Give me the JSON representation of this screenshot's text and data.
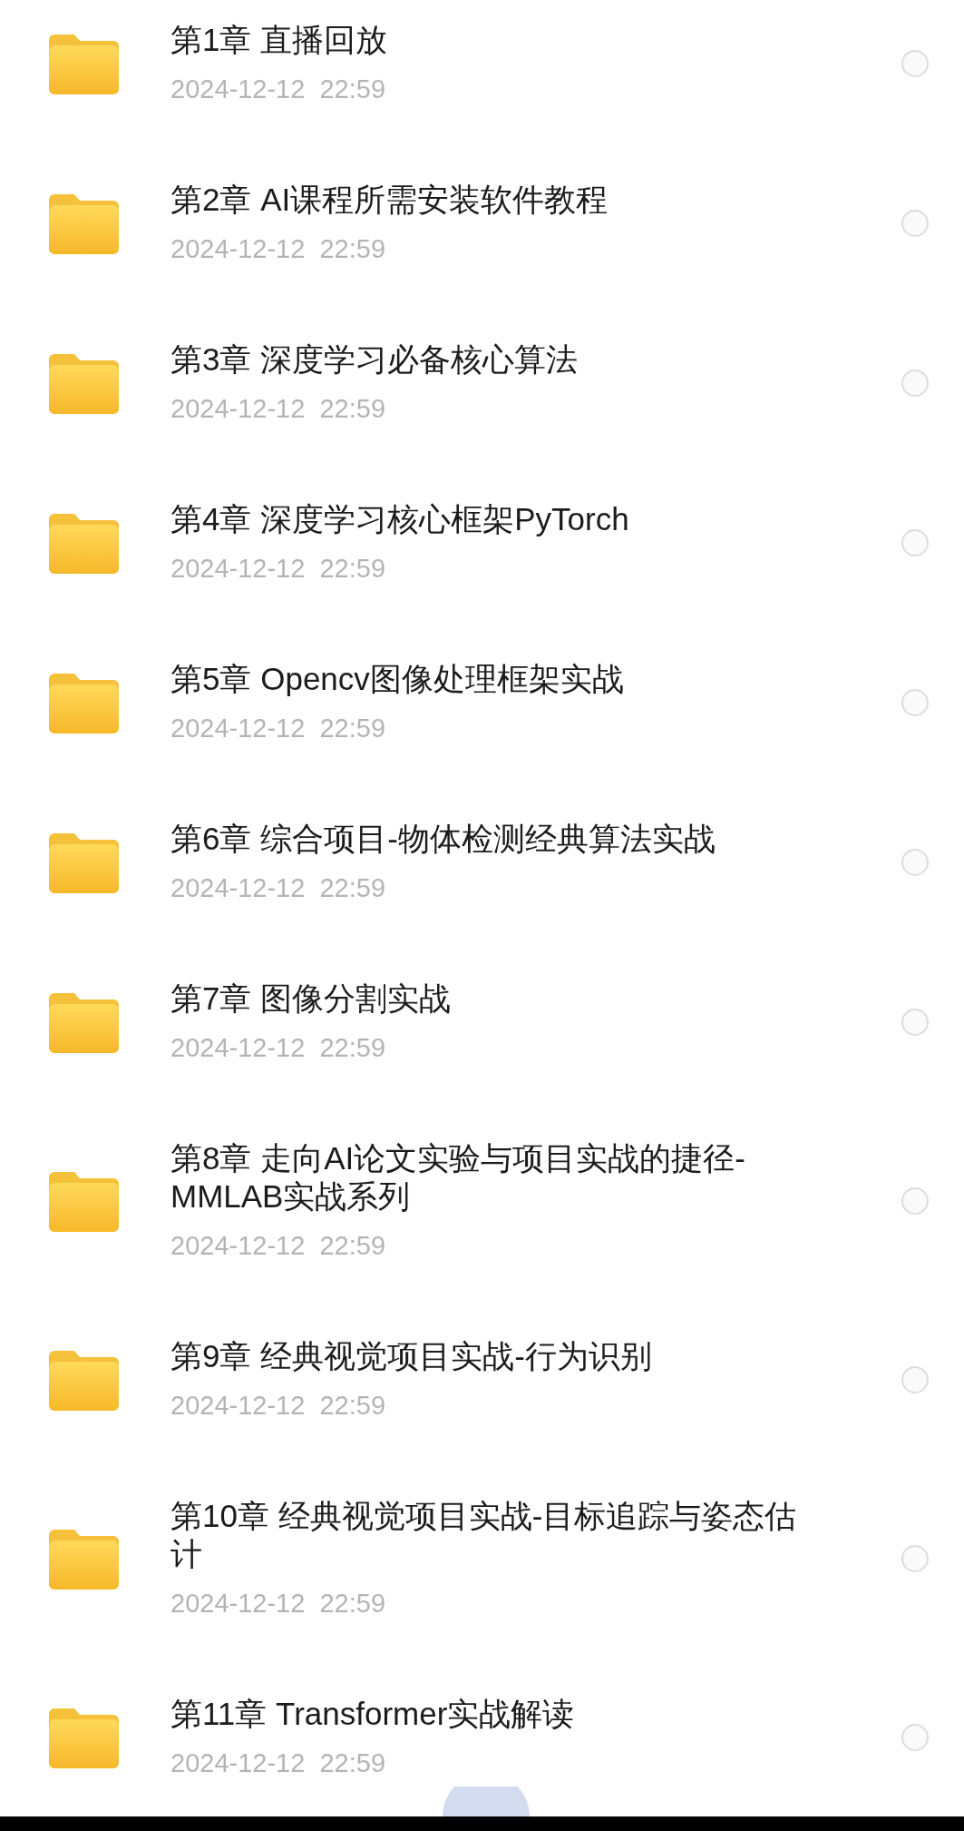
{
  "files": [
    {
      "title": "第1章 直播回放",
      "date": "2024-12-12  22:59",
      "selected": false
    },
    {
      "title": "第2章 AI课程所需安装软件教程",
      "date": "2024-12-12  22:59",
      "selected": false
    },
    {
      "title": "第3章 深度学习必备核心算法",
      "date": "2024-12-12  22:59",
      "selected": false
    },
    {
      "title": "第4章 深度学习核心框架PyTorch",
      "date": "2024-12-12  22:59",
      "selected": false
    },
    {
      "title": "第5章 Opencv图像处理框架实战",
      "date": "2024-12-12  22:59",
      "selected": false
    },
    {
      "title": "第6章 综合项目-物体检测经典算法实战",
      "date": "2024-12-12  22:59",
      "selected": false
    },
    {
      "title": "第7章 图像分割实战",
      "date": "2024-12-12  22:59",
      "selected": false
    },
    {
      "title": "第8章 走向AI论文实验与项目实战的捷径-MMLAB实战系列",
      "date": "2024-12-12  22:59",
      "selected": false
    },
    {
      "title": "第9章 经典视觉项目实战-行为识别",
      "date": "2024-12-12  22:59",
      "selected": false
    },
    {
      "title": "第10章 经典视觉项目实战-目标追踪与姿态估计",
      "date": "2024-12-12  22:59",
      "selected": false
    },
    {
      "title": "第11章 Transformer实战解读",
      "date": "2024-12-12  22:59",
      "selected": false
    }
  ]
}
